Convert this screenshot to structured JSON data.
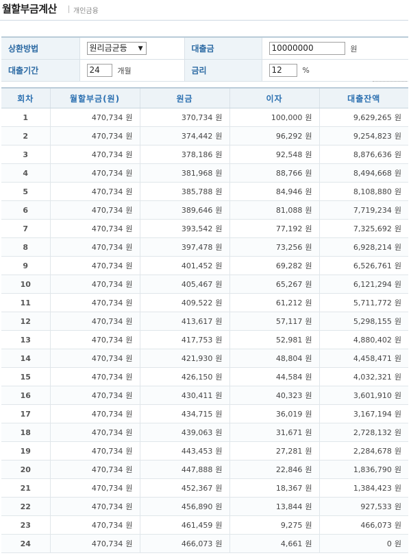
{
  "header": {
    "title": "월할부금계산",
    "subtitle": "개인금융"
  },
  "form": {
    "method_label": "상환방법",
    "method_value": "원리금균등",
    "amount_label": "대출금",
    "amount_value": "10000000",
    "amount_unit": "원",
    "period_label": "대출기간",
    "period_value": "24",
    "period_unit": "개월",
    "rate_label": "금리",
    "rate_value": "12",
    "rate_unit": "%"
  },
  "table": {
    "headers": [
      "회차",
      "월할부금(원)",
      "원금",
      "이자",
      "대출잔액"
    ],
    "unit": "원",
    "rows": [
      [
        "1",
        "470,734",
        "370,734",
        "100,000",
        "9,629,265"
      ],
      [
        "2",
        "470,734",
        "374,442",
        "96,292",
        "9,254,823"
      ],
      [
        "3",
        "470,734",
        "378,186",
        "92,548",
        "8,876,636"
      ],
      [
        "4",
        "470,734",
        "381,968",
        "88,766",
        "8,494,668"
      ],
      [
        "5",
        "470,734",
        "385,788",
        "84,946",
        "8,108,880"
      ],
      [
        "6",
        "470,734",
        "389,646",
        "81,088",
        "7,719,234"
      ],
      [
        "7",
        "470,734",
        "393,542",
        "77,192",
        "7,325,692"
      ],
      [
        "8",
        "470,734",
        "397,478",
        "73,256",
        "6,928,214"
      ],
      [
        "9",
        "470,734",
        "401,452",
        "69,282",
        "6,526,761"
      ],
      [
        "10",
        "470,734",
        "405,467",
        "65,267",
        "6,121,294"
      ],
      [
        "11",
        "470,734",
        "409,522",
        "61,212",
        "5,711,772"
      ],
      [
        "12",
        "470,734",
        "413,617",
        "57,117",
        "5,298,155"
      ],
      [
        "13",
        "470,734",
        "417,753",
        "52,981",
        "4,880,402"
      ],
      [
        "14",
        "470,734",
        "421,930",
        "48,804",
        "4,458,471"
      ],
      [
        "15",
        "470,734",
        "426,150",
        "44,584",
        "4,032,321"
      ],
      [
        "16",
        "470,734",
        "430,411",
        "40,323",
        "3,601,910"
      ],
      [
        "17",
        "470,734",
        "434,715",
        "36,019",
        "3,167,194"
      ],
      [
        "18",
        "470,734",
        "439,063",
        "31,671",
        "2,728,132"
      ],
      [
        "19",
        "470,734",
        "443,453",
        "27,281",
        "2,284,678"
      ],
      [
        "20",
        "470,734",
        "447,888",
        "22,846",
        "1,836,790"
      ],
      [
        "21",
        "470,734",
        "452,367",
        "18,367",
        "1,384,423"
      ],
      [
        "22",
        "470,734",
        "456,890",
        "13,844",
        "927,533"
      ],
      [
        "23",
        "470,734",
        "461,459",
        "9,275",
        "466,073"
      ],
      [
        "24",
        "470,734",
        "466,073",
        "4,661",
        "0"
      ]
    ]
  }
}
